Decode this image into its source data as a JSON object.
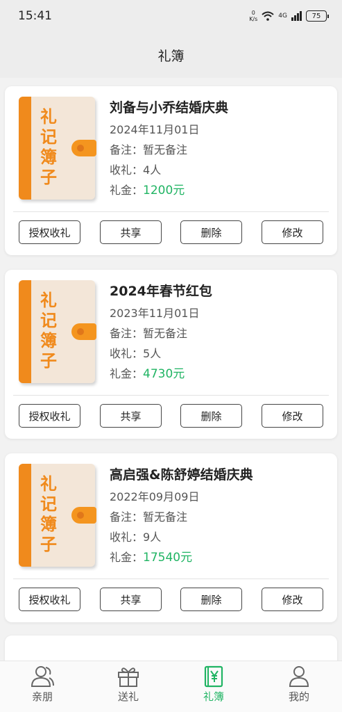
{
  "status": {
    "time": "15:41",
    "speed_value": "0",
    "speed_unit": "K/s",
    "network": "4G",
    "battery": "75"
  },
  "header": {
    "title": "礼簿"
  },
  "book_label": "礼记簿子",
  "labels": {
    "note": "备注：",
    "receive": "收礼：",
    "amount": "礼金："
  },
  "buttons": {
    "authorize": "授权收礼",
    "share": "共享",
    "delete": "删除",
    "edit": "修改"
  },
  "cards": [
    {
      "title": "刘备与小乔结婚庆典",
      "date": "2024年11月01日",
      "note": "暂无备注",
      "receive": "4人",
      "amount": "1200元"
    },
    {
      "title": "2024年春节红包",
      "date": "2023年11月01日",
      "note": "暂无备注",
      "receive": "5人",
      "amount": "4730元"
    },
    {
      "title": "高启强&陈舒婷结婚庆典",
      "date": "2022年09月09日",
      "note": "暂无备注",
      "receive": "9人",
      "amount": "17540元"
    }
  ],
  "tabs": [
    {
      "label": "亲朋",
      "icon": "people-icon"
    },
    {
      "label": "送礼",
      "icon": "gift-icon"
    },
    {
      "label": "礼簿",
      "icon": "yen-book-icon"
    },
    {
      "label": "我的",
      "icon": "user-icon"
    }
  ],
  "colors": {
    "accent": "#20b463",
    "book_orange": "#f08a1c",
    "book_cover": "#f3e6d8"
  }
}
